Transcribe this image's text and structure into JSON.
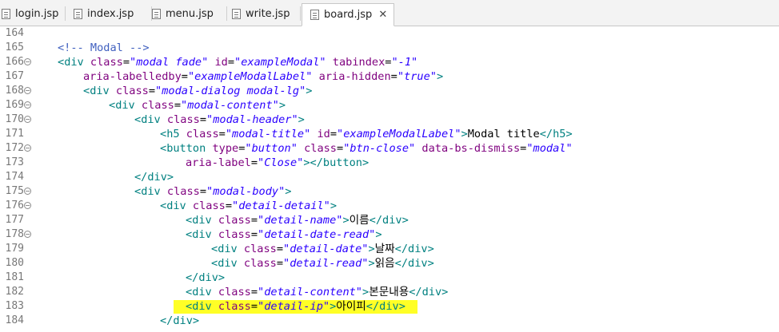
{
  "tabs": [
    {
      "label": "login.jsp"
    },
    {
      "label": "index.jsp"
    },
    {
      "label": "menu.jsp"
    },
    {
      "label": "write.jsp"
    },
    {
      "label": "board.jsp",
      "close": "✕"
    }
  ],
  "line_numbers": [
    "164",
    "165",
    "166",
    "167",
    "168",
    "169",
    "170",
    "171",
    "172",
    "173",
    "174",
    "175",
    "176",
    "177",
    "178",
    "179",
    "180",
    "181",
    "182",
    "183",
    "184"
  ],
  "code": {
    "l165": {
      "comment": "<!-- Modal -->"
    },
    "l166": {
      "o": "<",
      "tag": "div",
      "a1": " class",
      "eq1": "=",
      "v1": "\"modal fade\"",
      "a2": " id",
      "eq2": "=",
      "v2": "\"exampleModal\"",
      "a3": " tabindex",
      "eq3": "=",
      "v3": "\"-1\""
    },
    "l167": {
      "a1": "aria-labelledby",
      "eq1": "=",
      "v1": "\"exampleModalLabel\"",
      "a2": " aria-hidden",
      "eq2": "=",
      "v2": "\"true\"",
      "c": ">"
    },
    "l168": {
      "o": "<",
      "tag": "div",
      "a1": " class",
      "eq1": "=",
      "v1": "\"modal-dialog modal-lg\"",
      "c": ">"
    },
    "l169": {
      "o": "<",
      "tag": "div",
      "a1": " class",
      "eq1": "=",
      "v1": "\"modal-content\"",
      "c": ">"
    },
    "l170": {
      "o": "<",
      "tag": "div",
      "a1": " class",
      "eq1": "=",
      "v1": "\"modal-header\"",
      "c": ">"
    },
    "l171": {
      "o": "<",
      "tag": "h5",
      "a1": " class",
      "eq1": "=",
      "v1": "\"modal-title\"",
      "a2": " id",
      "eq2": "=",
      "v2": "\"exampleModalLabel\"",
      "c": ">",
      "text": "Modal title",
      "close": "</h5>"
    },
    "l172": {
      "o": "<",
      "tag": "button",
      "a1": " type",
      "eq1": "=",
      "v1": "\"button\"",
      "a2": " class",
      "eq2": "=",
      "v2": "\"btn-close\"",
      "a3": " data-bs-dismiss",
      "eq3": "=",
      "v3": "\"modal\""
    },
    "l173": {
      "a1": "aria-label",
      "eq1": "=",
      "v1": "\"Close\"",
      "c": "></button>"
    },
    "l174": {
      "close": "</div>"
    },
    "l175": {
      "o": "<",
      "tag": "div",
      "a1": " class",
      "eq1": "=",
      "v1": "\"modal-body\"",
      "c": ">"
    },
    "l176": {
      "o": "<",
      "tag": "div",
      "a1": " class",
      "eq1": "=",
      "v1": "\"detail-detail\"",
      "c": ">"
    },
    "l177": {
      "o": "<",
      "tag": "div",
      "a1": " class",
      "eq1": "=",
      "v1": "\"detail-name\"",
      "c": ">",
      "text": "이름",
      "close": "</div>"
    },
    "l178": {
      "o": "<",
      "tag": "div",
      "a1": " class",
      "eq1": "=",
      "v1": "\"detail-date-read\"",
      "c": ">"
    },
    "l179": {
      "o": "<",
      "tag": "div",
      "a1": " class",
      "eq1": "=",
      "v1": "\"detail-date\"",
      "c": ">",
      "text": "날짜",
      "close": "</div>"
    },
    "l180": {
      "o": "<",
      "tag": "div",
      "a1": " class",
      "eq1": "=",
      "v1": "\"detail-read\"",
      "c": ">",
      "text": "읽음",
      "close": "</div>"
    },
    "l181": {
      "close": "</div>"
    },
    "l182": {
      "o": "<",
      "tag": "div",
      "a1": " class",
      "eq1": "=",
      "v1": "\"detail-content\"",
      "c": ">",
      "text": "본문내용",
      "close": "</div>"
    },
    "l183": {
      "o": "<",
      "tag": "div",
      "a1": " class",
      "eq1": "=",
      "v1": "\"detail-ip\"",
      "c": ">",
      "text": "아이피",
      "close": "</div>"
    },
    "l184": {
      "close": "</div>"
    }
  },
  "colors": {
    "tag": "#008080",
    "attr": "#7f007f",
    "value": "#2a00ff",
    "comment": "#3f5fbf",
    "highlight": "#ffff00"
  }
}
